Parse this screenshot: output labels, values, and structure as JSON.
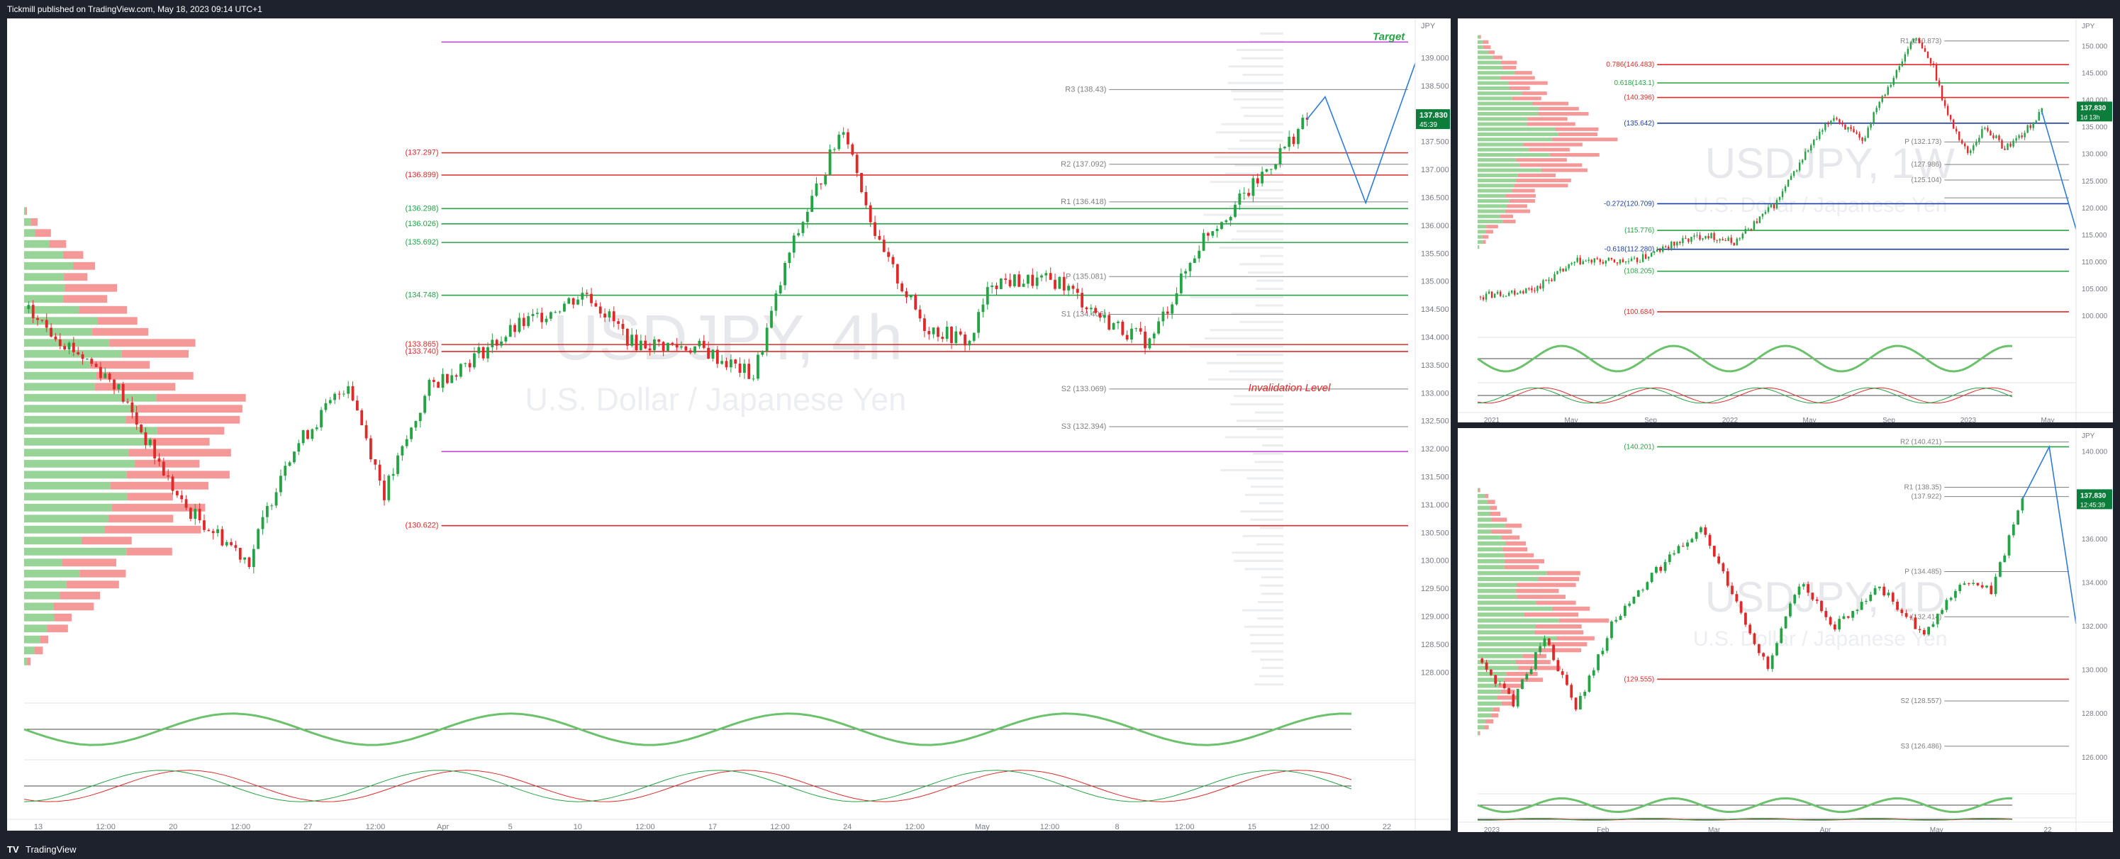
{
  "header": {
    "text": "Tickmill published on TradingView.com, May 18, 2023 09:14 UTC+1"
  },
  "footer": {
    "logo": "TV",
    "brand": "TradingView"
  },
  "colors": {
    "bull": "#26a344",
    "bear": "#e02a2a",
    "bullVol": "#6cc26c",
    "bearVol": "#f07575",
    "target": "#c24cdb",
    "fib": "#1b3fa6",
    "projection": "#2f7bd9",
    "price": "#0d7d3b"
  },
  "chart_data": [
    {
      "id": "main",
      "type": "candlestick",
      "symbol": "USDJPY",
      "timeframe": "4h",
      "watermark_symbol": "USDJPY, 4h",
      "watermark_desc": "U.S. Dollar / Japanese Yen",
      "ylim": [
        127.7,
        139.5
      ],
      "y_ticks": [
        "139.000",
        "138.500",
        "138.000",
        "137.500",
        "137.000",
        "136.500",
        "136.000",
        "135.500",
        "135.000",
        "134.500",
        "134.000",
        "133.500",
        "133.000",
        "132.500",
        "132.000",
        "131.500",
        "131.000",
        "130.500",
        "130.000",
        "129.500",
        "129.000",
        "128.500",
        "128.000"
      ],
      "x_ticks": [
        "13",
        "12:00",
        "20",
        "12:00",
        "27",
        "12:00",
        "Apr",
        "5",
        "10",
        "12:00",
        "17",
        "12:00",
        "24",
        "12:00",
        "May",
        "12:00",
        "8",
        "12:00",
        "15",
        "12:00",
        "22"
      ],
      "axis_unit": "JPY",
      "price_tag": {
        "value": "137.830",
        "countdown": "45:39"
      },
      "path": [
        [
          0,
          134.5
        ],
        [
          20,
          133.2
        ],
        [
          35,
          131.0
        ],
        [
          50,
          130.0
        ],
        [
          58,
          131.8
        ],
        [
          72,
          133.2
        ],
        [
          80,
          131.2
        ],
        [
          90,
          133.1
        ],
        [
          110,
          134.2
        ],
        [
          125,
          134.8
        ],
        [
          135,
          133.9
        ],
        [
          150,
          133.8
        ],
        [
          162,
          133.3
        ],
        [
          170,
          135.5
        ],
        [
          182,
          137.8
        ],
        [
          190,
          135.6
        ],
        [
          200,
          134.2
        ],
        [
          210,
          133.9
        ],
        [
          215,
          135.0
        ],
        [
          230,
          135.0
        ],
        [
          240,
          134.3
        ],
        [
          250,
          133.9
        ],
        [
          262,
          135.8
        ],
        [
          272,
          136.6
        ],
        [
          285,
          137.9
        ]
      ],
      "h_levels": [
        {
          "value": 139.28,
          "label": "",
          "color": "#c24cdb"
        },
        {
          "value": 138.43,
          "label": "R3 (138.43)",
          "color": "#808080"
        },
        {
          "value": 137.297,
          "label": "(137.297)",
          "color": "#e02a2a"
        },
        {
          "value": 137.092,
          "label": "R2 (137.092)",
          "color": "#808080"
        },
        {
          "value": 136.899,
          "label": "(136.899)",
          "color": "#e02a2a"
        },
        {
          "value": 136.418,
          "label": "R1 (136.418)",
          "color": "#808080"
        },
        {
          "value": 136.298,
          "label": "(136.298)",
          "color": "#26a344"
        },
        {
          "value": 136.026,
          "label": "(136.026)",
          "color": "#26a344"
        },
        {
          "value": 135.692,
          "label": "(135.692)",
          "color": "#26a344"
        },
        {
          "value": 135.081,
          "label": "P (135.081)",
          "color": "#808080"
        },
        {
          "value": 134.748,
          "label": "(134.748)",
          "color": "#26a344"
        },
        {
          "value": 134.406,
          "label": "S1 (134.406)",
          "color": "#808080"
        },
        {
          "value": 133.865,
          "label": "(133.865)",
          "color": "#e02a2a"
        },
        {
          "value": 133.74,
          "label": "(133.740)",
          "color": "#e02a2a"
        },
        {
          "value": 133.069,
          "label": "S2 (133.069)",
          "color": "#808080"
        },
        {
          "value": 132.394,
          "label": "S3 (132.394)",
          "color": "#808080"
        },
        {
          "value": 131.95,
          "label": "",
          "color": "#c24cdb"
        },
        {
          "value": 130.622,
          "label": "(130.622)",
          "color": "#e02a2a"
        }
      ],
      "annotations": [
        {
          "text": "Target",
          "color": "#26a344"
        },
        {
          "text": "Invalidation Level",
          "color": "#e02a2a"
        }
      ],
      "projection": [
        [
          285,
          137.9
        ],
        [
          289,
          138.3
        ],
        [
          298,
          136.4
        ],
        [
          309,
          138.9
        ]
      ]
    },
    {
      "id": "top-right",
      "type": "candlestick",
      "symbol": "USDJPY",
      "timeframe": "1W",
      "watermark_symbol": "USDJPY, 1W",
      "watermark_desc": "U.S. Dollar / Japanese Yen",
      "ylim": [
        97.0,
        154.0
      ],
      "y_ticks": [
        "150.000",
        "145.000",
        "140.000",
        "135.000",
        "130.000",
        "125.000",
        "120.000",
        "115.000",
        "110.000",
        "105.000",
        "100.000"
      ],
      "x_ticks": [
        "2021",
        "May",
        "Sep",
        "2022",
        "May",
        "Sep",
        "2023",
        "May"
      ],
      "axis_unit": "JPY",
      "price_tag": {
        "value": "137.830",
        "countdown": "1d 13h"
      },
      "path": [
        [
          0,
          103.5
        ],
        [
          20,
          105
        ],
        [
          35,
          110
        ],
        [
          55,
          110
        ],
        [
          70,
          113.5
        ],
        [
          80,
          115
        ],
        [
          90,
          113.5
        ],
        [
          105,
          121
        ],
        [
          115,
          130
        ],
        [
          125,
          137
        ],
        [
          135,
          132
        ],
        [
          140,
          139
        ],
        [
          148,
          146
        ],
        [
          153,
          151.8
        ],
        [
          160,
          146
        ],
        [
          165,
          137
        ],
        [
          172,
          130
        ],
        [
          178,
          135
        ],
        [
          185,
          131
        ],
        [
          192,
          134
        ],
        [
          198,
          137.8
        ]
      ],
      "h_levels": [
        {
          "value": 150.873,
          "label": "R1 (150.873)",
          "color": "#808080"
        },
        {
          "value": 146.483,
          "label": "0.786(146.483)",
          "color": "#e02a2a"
        },
        {
          "value": 143.1,
          "label": "0.618(143.1)",
          "color": "#26a344"
        },
        {
          "value": 140.396,
          "label": "(140.396)",
          "color": "#e02a2a"
        },
        {
          "value": 135.642,
          "label": "(135.642)",
          "color": "#1b3fa6"
        },
        {
          "value": 132.173,
          "label": "P (132.173)",
          "color": "#808080"
        },
        {
          "value": 127.986,
          "label": "(127.986)",
          "color": "#808080"
        },
        {
          "value": 125.104,
          "label": "(125.104)",
          "color": "#808080"
        },
        {
          "value": 121.8,
          "label": "",
          "color": "#808080"
        },
        {
          "value": 120.709,
          "label": "-0.272(120.709)",
          "color": "#1b3fa6"
        },
        {
          "value": 115.776,
          "label": "(115.776)",
          "color": "#26a344"
        },
        {
          "value": 112.28,
          "label": "-0.618(112.280)",
          "color": "#1b3fa6"
        },
        {
          "value": 108.205,
          "label": "(108.205)",
          "color": "#26a344"
        },
        {
          "value": 100.684,
          "label": "(100.684)",
          "color": "#e02a2a"
        }
      ],
      "projection": [
        [
          198,
          137.8
        ],
        [
          210,
          116
        ]
      ]
    },
    {
      "id": "bottom-right",
      "type": "candlestick",
      "symbol": "USDJPY",
      "timeframe": "1D",
      "watermark_symbol": "USDJPY, 1D",
      "watermark_desc": "U.S. Dollar / Japanese Yen",
      "ylim": [
        124.5,
        140.8
      ],
      "y_ticks": [
        "140.000",
        "138.000",
        "136.000",
        "134.000",
        "132.000",
        "130.000",
        "128.000",
        "126.000"
      ],
      "x_ticks": [
        "2023",
        "Feb",
        "Mar",
        "Apr",
        "May",
        "22"
      ],
      "axis_unit": "JPY",
      "price_tag": {
        "value": "137.830",
        "countdown": "12:45:39"
      },
      "path": [
        [
          0,
          130.5
        ],
        [
          8,
          128.5
        ],
        [
          15,
          131.5
        ],
        [
          22,
          128.2
        ],
        [
          30,
          132
        ],
        [
          40,
          134.5
        ],
        [
          50,
          136.5
        ],
        [
          58,
          133
        ],
        [
          65,
          130
        ],
        [
          72,
          134
        ],
        [
          80,
          132
        ],
        [
          90,
          133.8
        ],
        [
          100,
          131.5
        ],
        [
          108,
          134
        ],
        [
          115,
          133.6
        ],
        [
          122,
          137.8
        ]
      ],
      "h_levels": [
        {
          "value": 140.201,
          "label": "(140.201)",
          "color": "#26a344"
        },
        {
          "value": 140.421,
          "label": "R2 (140.421)",
          "color": "#808080"
        },
        {
          "value": 138.35,
          "label": "R1 (138.35)",
          "color": "#808080"
        },
        {
          "value": 137.922,
          "label": "(137.922)",
          "color": "#808080"
        },
        {
          "value": 134.485,
          "label": "P (134.485)",
          "color": "#808080"
        },
        {
          "value": 132.414,
          "label": "(132.414)",
          "color": "#808080"
        },
        {
          "value": 129.555,
          "label": "(129.555)",
          "color": "#e02a2a"
        },
        {
          "value": 128.557,
          "label": "S2 (128.557)",
          "color": "#808080"
        },
        {
          "value": 126.486,
          "label": "S3 (126.486)",
          "color": "#808080"
        }
      ],
      "projection": [
        [
          122,
          137.8
        ],
        [
          128,
          140.2
        ],
        [
          134,
          132.1
        ]
      ]
    }
  ]
}
